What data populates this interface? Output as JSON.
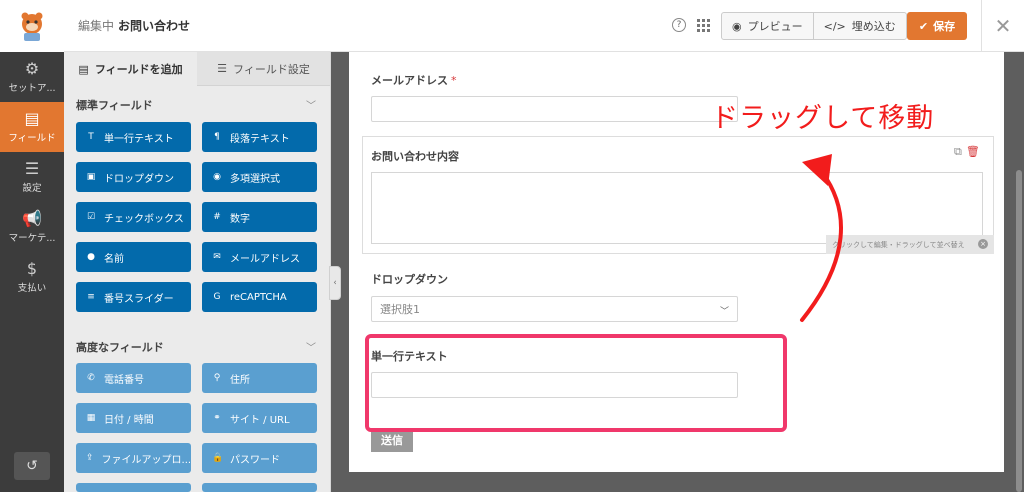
{
  "header": {
    "editing_label": "編集中",
    "form_title": "お問い合わせ",
    "help_glyph": "?",
    "preview_label": "プレビュー",
    "embed_label": "埋め込む",
    "save_label": "保存",
    "close_glyph": "✕"
  },
  "leftnav": {
    "items": [
      {
        "label": "セットア...",
        "icon": "gear-icon",
        "glyph": "⚙"
      },
      {
        "label": "フィールド",
        "icon": "fields-icon",
        "glyph": "▤"
      },
      {
        "label": "設定",
        "icon": "sliders-icon",
        "glyph": "☰"
      },
      {
        "label": "マーケテ...",
        "icon": "megaphone-icon",
        "glyph": "📢"
      },
      {
        "label": "支払い",
        "icon": "dollar-icon",
        "glyph": "$"
      }
    ],
    "revision_glyph": "↺"
  },
  "panel": {
    "tab_add": "フィールドを追加",
    "tab_options": "フィールド設定",
    "standard_heading": "標準フィールド",
    "advanced_heading": "高度なフィールド",
    "standard_fields": [
      {
        "label": "単一行テキスト",
        "icon": "text-icon",
        "glyph": "T"
      },
      {
        "label": "段落テキスト",
        "icon": "paragraph-icon",
        "glyph": "¶"
      },
      {
        "label": "ドロップダウン",
        "icon": "dropdown-icon",
        "glyph": "▣"
      },
      {
        "label": "多項選択式",
        "icon": "radio-icon",
        "glyph": "◉"
      },
      {
        "label": "チェックボックス",
        "icon": "checkbox-icon",
        "glyph": "☑"
      },
      {
        "label": "数字",
        "icon": "hash-icon",
        "glyph": "#"
      },
      {
        "label": "名前",
        "icon": "user-icon",
        "glyph": "●"
      },
      {
        "label": "メールアドレス",
        "icon": "envelope-icon",
        "glyph": "✉"
      },
      {
        "label": "番号スライダー",
        "icon": "slider-icon",
        "glyph": "≡"
      },
      {
        "label": "reCAPTCHA",
        "icon": "google-icon",
        "glyph": "G"
      }
    ],
    "advanced_fields": [
      {
        "label": "電話番号",
        "icon": "phone-icon",
        "glyph": "✆"
      },
      {
        "label": "住所",
        "icon": "map-pin-icon",
        "glyph": "⚲"
      },
      {
        "label": "日付 / 時間",
        "icon": "calendar-icon",
        "glyph": "▦"
      },
      {
        "label": "サイト / URL",
        "icon": "link-icon",
        "glyph": "⚭"
      },
      {
        "label": "ファイルアップロ...",
        "icon": "upload-icon",
        "glyph": "⇪"
      },
      {
        "label": "パスワード",
        "icon": "lock-icon",
        "glyph": "🔒"
      }
    ]
  },
  "form": {
    "email_label": "メールアドレス",
    "required_mark": "*",
    "message_label": "お問い合わせ内容",
    "hint_text": "クリックして編集・ドラッグして並べ替え",
    "dropdown_label": "ドロップダウン",
    "dropdown_value": "選択肢1",
    "single_line_label": "単一行テキスト",
    "submit_label": "送信"
  },
  "annotation": {
    "text": "ドラッグして移動",
    "color": "#f21c1c",
    "box_color": "#f0386b"
  },
  "colors": {
    "accent": "#e27730",
    "field_button": "#036aab",
    "advanced_button": "#5a9fd0"
  }
}
